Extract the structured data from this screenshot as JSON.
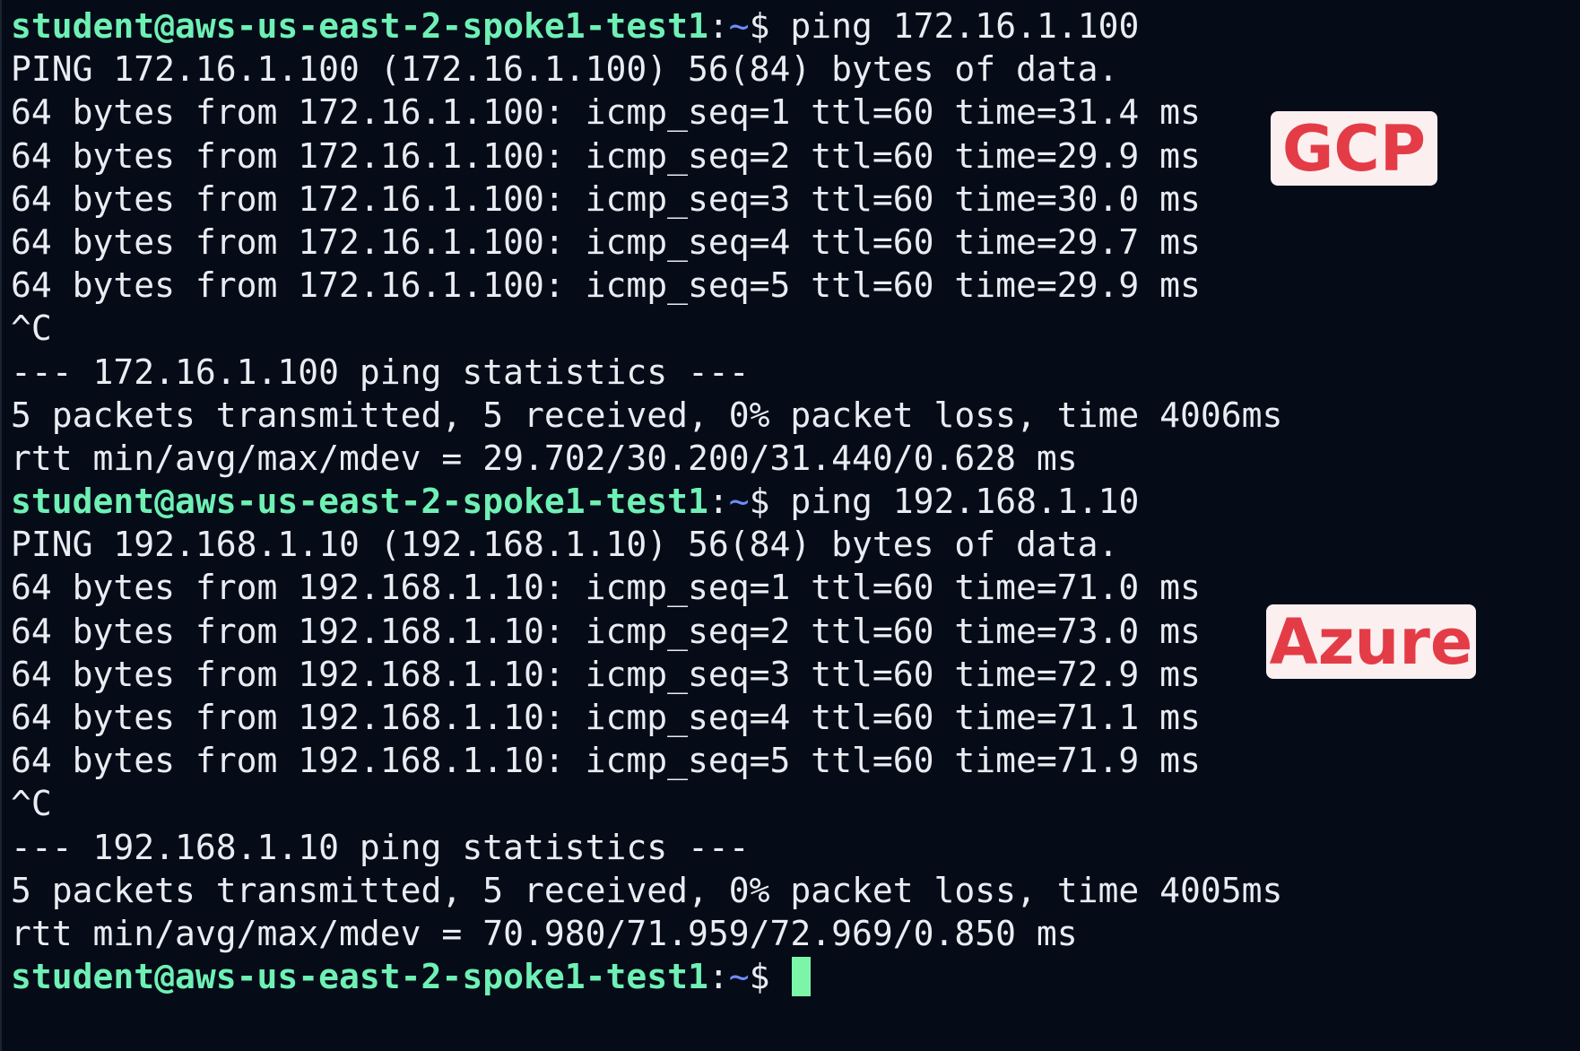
{
  "terminal": {
    "prompt": {
      "user_host": "student@aws-us-east-2-spoke1-test1",
      "colon": ":",
      "path": "~",
      "dollar": "$"
    },
    "lines": [
      {
        "type": "prompt",
        "command": " ping 172.16.1.100"
      },
      {
        "type": "output",
        "text": "PING 172.16.1.100 (172.16.1.100) 56(84) bytes of data."
      },
      {
        "type": "output",
        "text": "64 bytes from 172.16.1.100: icmp_seq=1 ttl=60 time=31.4 ms"
      },
      {
        "type": "output",
        "text": "64 bytes from 172.16.1.100: icmp_seq=2 ttl=60 time=29.9 ms"
      },
      {
        "type": "output",
        "text": "64 bytes from 172.16.1.100: icmp_seq=3 ttl=60 time=30.0 ms"
      },
      {
        "type": "output",
        "text": "64 bytes from 172.16.1.100: icmp_seq=4 ttl=60 time=29.7 ms"
      },
      {
        "type": "output",
        "text": "64 bytes from 172.16.1.100: icmp_seq=5 ttl=60 time=29.9 ms"
      },
      {
        "type": "output",
        "text": "^C"
      },
      {
        "type": "output",
        "text": "--- 172.16.1.100 ping statistics ---"
      },
      {
        "type": "output",
        "text": "5 packets transmitted, 5 received, 0% packet loss, time 4006ms"
      },
      {
        "type": "output",
        "text": "rtt min/avg/max/mdev = 29.702/30.200/31.440/0.628 ms"
      },
      {
        "type": "prompt",
        "command": " ping 192.168.1.10"
      },
      {
        "type": "output",
        "text": "PING 192.168.1.10 (192.168.1.10) 56(84) bytes of data."
      },
      {
        "type": "output",
        "text": "64 bytes from 192.168.1.10: icmp_seq=1 ttl=60 time=71.0 ms"
      },
      {
        "type": "output",
        "text": "64 bytes from 192.168.1.10: icmp_seq=2 ttl=60 time=73.0 ms"
      },
      {
        "type": "output",
        "text": "64 bytes from 192.168.1.10: icmp_seq=3 ttl=60 time=72.9 ms"
      },
      {
        "type": "output",
        "text": "64 bytes from 192.168.1.10: icmp_seq=4 ttl=60 time=71.1 ms"
      },
      {
        "type": "output",
        "text": "64 bytes from 192.168.1.10: icmp_seq=5 ttl=60 time=71.9 ms"
      },
      {
        "type": "output",
        "text": "^C"
      },
      {
        "type": "output",
        "text": "--- 192.168.1.10 ping statistics ---"
      },
      {
        "type": "output",
        "text": "5 packets transmitted, 5 received, 0% packet loss, time 4005ms"
      },
      {
        "type": "output",
        "text": "rtt min/avg/max/mdev = 70.980/71.959/72.969/0.850 ms"
      },
      {
        "type": "prompt",
        "command": " ",
        "cursor": true
      }
    ]
  },
  "annotations": {
    "gcp_label": "GCP",
    "azure_label": "Azure"
  },
  "colors": {
    "background": "#050c18",
    "text": "#e9edf2",
    "prompt_user": "#6ff0b4",
    "prompt_path": "#6f8dff",
    "cursor": "#7cf5a8",
    "badge_background": "#fbeff0",
    "badge_text": "#e43c47"
  }
}
